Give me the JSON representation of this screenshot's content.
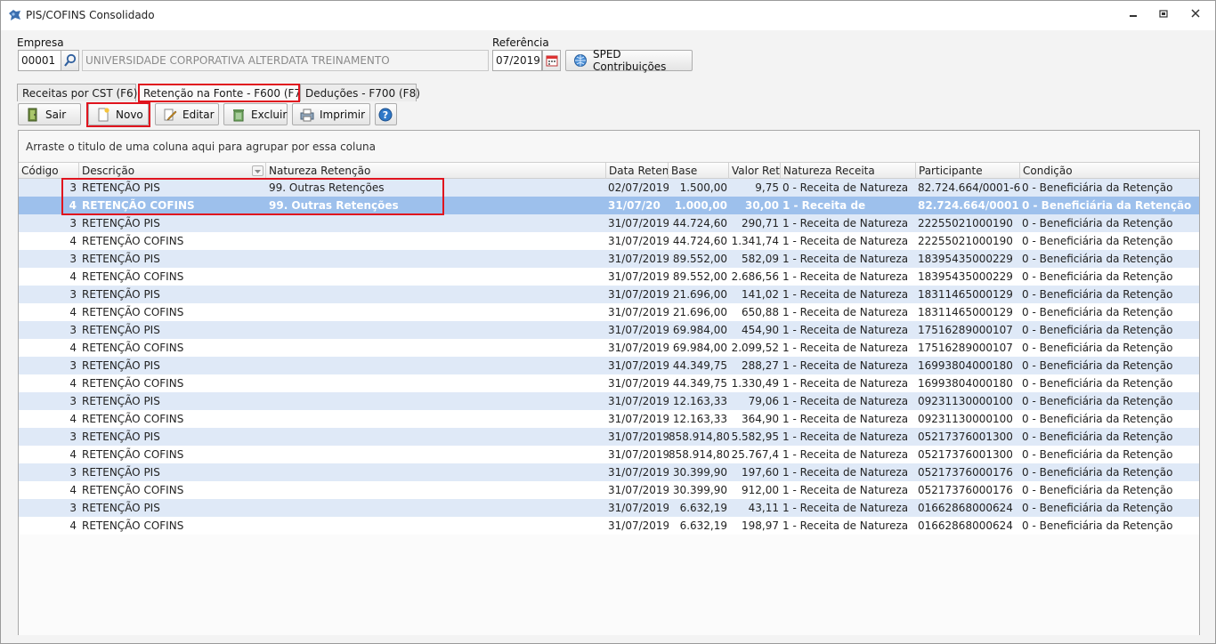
{
  "window": {
    "title": "PIS/COFINS Consolidado",
    "buttons": [
      "minimize",
      "maximize",
      "close"
    ]
  },
  "form": {
    "empresa_label": "Empresa",
    "empresa_code": "00001",
    "empresa_name": "UNIVERSIDADE CORPORATIVA ALTERDATA TREINAMENTO",
    "referencia_label": "Referência",
    "referencia_value": "07/2019",
    "sped_label": "SPED Contribuições"
  },
  "tabs": [
    {
      "label": "Receitas por CST (F6)"
    },
    {
      "label": "Retenção na Fonte - F600 (F7)"
    },
    {
      "label": "Deduções - F700 (F8)"
    }
  ],
  "toolbar": {
    "sair": "Sair",
    "novo": "Novo",
    "editar": "Editar",
    "excluir": "Excluir",
    "imprimir": "Imprimir"
  },
  "grid": {
    "group_hint": "Arraste o titulo de uma coluna aqui para agrupar por essa coluna",
    "columns": [
      "Código",
      "Descrição",
      "Natureza Retenção",
      "Data Reten",
      "Base",
      "Valor Ret",
      "Natureza Receita",
      "Participante",
      "Condição"
    ],
    "rows": [
      {
        "cod": "3",
        "desc": "RETENÇÃO PIS",
        "nat": "99. Outras Retenções",
        "data": "02/07/2019",
        "base": "1.500,00",
        "valor": "9,75",
        "natrec": "0 - Receita de Natureza",
        "part": "82.724.664/0001-6",
        "cond": "0 - Beneficiária da Retenção"
      },
      {
        "cod": "4",
        "desc": "RETENÇÃO COFINS",
        "nat": "99. Outras Retenções",
        "data": "31/07/20",
        "base": "1.000,00",
        "valor": "30,00",
        "natrec": "1 - Receita de",
        "part": "82.724.664/0001",
        "cond": "0 - Beneficiária da Retenção"
      },
      {
        "cod": "3",
        "desc": "RETENÇÃO PIS",
        "nat": "",
        "data": "31/07/2019",
        "base": "44.724,60",
        "valor": "290,71",
        "natrec": "1 - Receita de Natureza",
        "part": "22255021000190",
        "cond": "0 - Beneficiária da Retenção"
      },
      {
        "cod": "4",
        "desc": "RETENÇÃO COFINS",
        "nat": "",
        "data": "31/07/2019",
        "base": "44.724,60",
        "valor": "1.341,74",
        "natrec": "1 - Receita de Natureza",
        "part": "22255021000190",
        "cond": "0 - Beneficiária da Retenção"
      },
      {
        "cod": "3",
        "desc": "RETENÇÃO PIS",
        "nat": "",
        "data": "31/07/2019",
        "base": "89.552,00",
        "valor": "582,09",
        "natrec": "1 - Receita de Natureza",
        "part": "18395435000229",
        "cond": "0 - Beneficiária da Retenção"
      },
      {
        "cod": "4",
        "desc": "RETENÇÃO COFINS",
        "nat": "",
        "data": "31/07/2019",
        "base": "89.552,00",
        "valor": "2.686,56",
        "natrec": "1 - Receita de Natureza",
        "part": "18395435000229",
        "cond": "0 - Beneficiária da Retenção"
      },
      {
        "cod": "3",
        "desc": "RETENÇÃO PIS",
        "nat": "",
        "data": "31/07/2019",
        "base": "21.696,00",
        "valor": "141,02",
        "natrec": "1 - Receita de Natureza",
        "part": "18311465000129",
        "cond": "0 - Beneficiária da Retenção"
      },
      {
        "cod": "4",
        "desc": "RETENÇÃO COFINS",
        "nat": "",
        "data": "31/07/2019",
        "base": "21.696,00",
        "valor": "650,88",
        "natrec": "1 - Receita de Natureza",
        "part": "18311465000129",
        "cond": "0 - Beneficiária da Retenção"
      },
      {
        "cod": "3",
        "desc": "RETENÇÃO PIS",
        "nat": "",
        "data": "31/07/2019",
        "base": "69.984,00",
        "valor": "454,90",
        "natrec": "1 - Receita de Natureza",
        "part": "17516289000107",
        "cond": "0 - Beneficiária da Retenção"
      },
      {
        "cod": "4",
        "desc": "RETENÇÃO COFINS",
        "nat": "",
        "data": "31/07/2019",
        "base": "69.984,00",
        "valor": "2.099,52",
        "natrec": "1 - Receita de Natureza",
        "part": "17516289000107",
        "cond": "0 - Beneficiária da Retenção"
      },
      {
        "cod": "3",
        "desc": "RETENÇÃO PIS",
        "nat": "",
        "data": "31/07/2019",
        "base": "44.349,75",
        "valor": "288,27",
        "natrec": "1 - Receita de Natureza",
        "part": "16993804000180",
        "cond": "0 - Beneficiária da Retenção"
      },
      {
        "cod": "4",
        "desc": "RETENÇÃO COFINS",
        "nat": "",
        "data": "31/07/2019",
        "base": "44.349,75",
        "valor": "1.330,49",
        "natrec": "1 - Receita de Natureza",
        "part": "16993804000180",
        "cond": "0 - Beneficiária da Retenção"
      },
      {
        "cod": "3",
        "desc": "RETENÇÃO PIS",
        "nat": "",
        "data": "31/07/2019",
        "base": "12.163,33",
        "valor": "79,06",
        "natrec": "1 - Receita de Natureza",
        "part": "09231130000100",
        "cond": "0 - Beneficiária da Retenção"
      },
      {
        "cod": "4",
        "desc": "RETENÇÃO COFINS",
        "nat": "",
        "data": "31/07/2019",
        "base": "12.163,33",
        "valor": "364,90",
        "natrec": "1 - Receita de Natureza",
        "part": "09231130000100",
        "cond": "0 - Beneficiária da Retenção"
      },
      {
        "cod": "3",
        "desc": "RETENÇÃO PIS",
        "nat": "",
        "data": "31/07/2019",
        "base": "858.914,80",
        "valor": "5.582,95",
        "natrec": "1 - Receita de Natureza",
        "part": "05217376001300",
        "cond": "0 - Beneficiária da Retenção"
      },
      {
        "cod": "4",
        "desc": "RETENÇÃO COFINS",
        "nat": "",
        "data": "31/07/2019",
        "base": "858.914,80",
        "valor": "25.767,4",
        "natrec": "1 - Receita de Natureza",
        "part": "05217376001300",
        "cond": "0 - Beneficiária da Retenção"
      },
      {
        "cod": "3",
        "desc": "RETENÇÃO PIS",
        "nat": "",
        "data": "31/07/2019",
        "base": "30.399,90",
        "valor": "197,60",
        "natrec": "1 - Receita de Natureza",
        "part": "05217376000176",
        "cond": "0 - Beneficiária da Retenção"
      },
      {
        "cod": "4",
        "desc": "RETENÇÃO COFINS",
        "nat": "",
        "data": "31/07/2019",
        "base": "30.399,90",
        "valor": "912,00",
        "natrec": "1 - Receita de Natureza",
        "part": "05217376000176",
        "cond": "0 - Beneficiária da Retenção"
      },
      {
        "cod": "3",
        "desc": "RETENÇÃO PIS",
        "nat": "",
        "data": "31/07/2019",
        "base": "6.632,19",
        "valor": "43,11",
        "natrec": "1 - Receita de Natureza",
        "part": "01662868000624",
        "cond": "0 - Beneficiária da Retenção"
      },
      {
        "cod": "4",
        "desc": "RETENÇÃO COFINS",
        "nat": "",
        "data": "31/07/2019",
        "base": "6.632,19",
        "valor": "198,97",
        "natrec": "1 - Receita de Natureza",
        "part": "01662868000624",
        "cond": "0 - Beneficiária da Retenção"
      }
    ]
  }
}
